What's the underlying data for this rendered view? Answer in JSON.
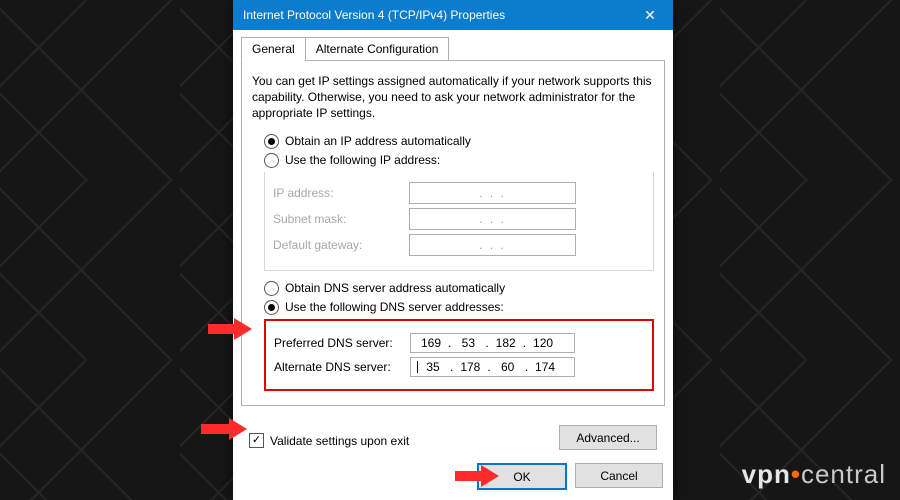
{
  "window": {
    "title": "Internet Protocol Version 4 (TCP/IPv4) Properties",
    "close_glyph": "✕"
  },
  "tabs": {
    "general": "General",
    "alt": "Alternate Configuration"
  },
  "intro": "You can get IP settings assigned automatically if your network supports this capability. Otherwise, you need to ask your network administrator for the appropriate IP settings.",
  "ip": {
    "auto_label": "Obtain an IP address automatically",
    "manual_label": "Use the following IP address:",
    "fields": {
      "address": "IP address:",
      "mask": "Subnet mask:",
      "gateway": "Default gateway:"
    },
    "placeholder": ".       .       ."
  },
  "dns": {
    "auto_label": "Obtain DNS server address automatically",
    "manual_label": "Use the following DNS server addresses:",
    "preferred_label": "Preferred DNS server:",
    "alternate_label": "Alternate DNS server:",
    "preferred": {
      "o1": "169",
      "o2": "53",
      "o3": "182",
      "o4": "120"
    },
    "alternate": {
      "o1": "35",
      "o2": "178",
      "o3": "60",
      "o4": "174"
    }
  },
  "validate": {
    "label": "Validate settings upon exit",
    "check": "✓"
  },
  "buttons": {
    "advanced": "Advanced...",
    "ok": "OK",
    "cancel": "Cancel"
  },
  "watermark": {
    "pre": "vpn",
    "post": "central"
  }
}
